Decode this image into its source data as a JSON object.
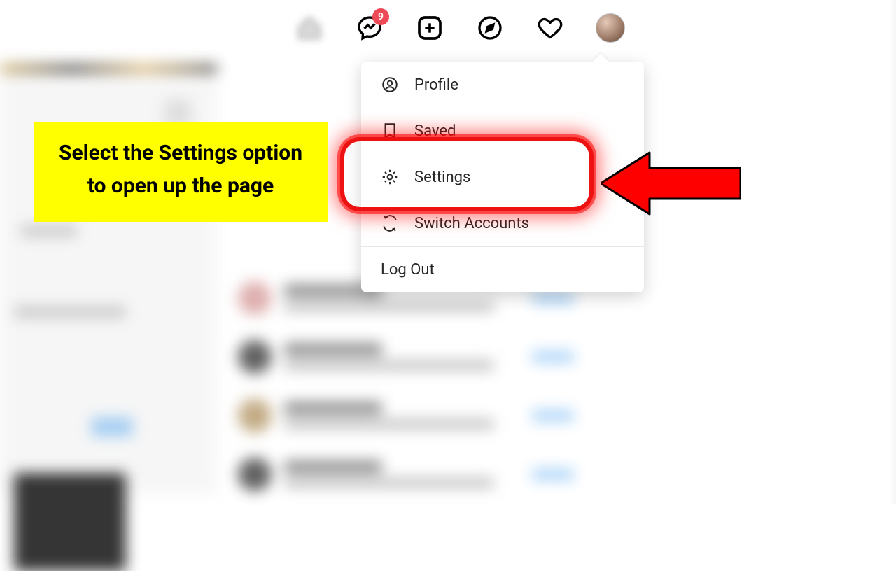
{
  "nav": {
    "messenger_badge": "9"
  },
  "menu": {
    "profile": "Profile",
    "saved": "Saved",
    "settings": "Settings",
    "switch": "Switch Accounts",
    "logout": "Log Out"
  },
  "callout": {
    "text": "Select the Settings option to open up the page"
  }
}
